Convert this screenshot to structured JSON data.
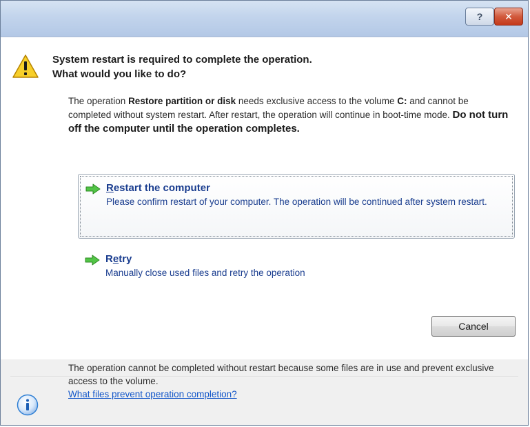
{
  "titlebar": {
    "help_label": "?",
    "close_label": "✕"
  },
  "dialog": {
    "heading_line1": "System restart is required to complete the operation.",
    "heading_line2": "What would you like to do?",
    "desc_part1": "The operation ",
    "desc_bold1": "Restore partition or disk",
    "desc_part2": " needs exclusive access to the volume ",
    "desc_bold2": "C:",
    "desc_part3": " and cannot be completed without system restart. After restart, the operation will continue in boot-time mode. ",
    "desc_bold3": "Do not turn off the computer until the operation completes."
  },
  "options": [
    {
      "title_access_key": "R",
      "title_rest": "estart the computer",
      "description": "Please confirm restart of your computer. The operation will be continued after system restart."
    },
    {
      "title_prefix": "R",
      "title_access_key": "e",
      "title_rest": "try",
      "description": "Manually close used files and retry the operation"
    }
  ],
  "buttons": {
    "cancel_label": "Cancel"
  },
  "footer": {
    "text": "The operation cannot be completed without restart because some files are in use and prevent exclusive access to the volume.",
    "link": "What files prevent operation completion?"
  },
  "colors": {
    "option_text": "#1a3d8f",
    "link": "#1256c9",
    "arrow": "#3cb93c",
    "warning": "#f2c200",
    "info": "#2f7fd4"
  },
  "icons": {
    "warning": "warning-icon",
    "arrow": "green-arrow-icon",
    "info": "info-icon",
    "help": "help-icon",
    "close": "close-icon"
  }
}
